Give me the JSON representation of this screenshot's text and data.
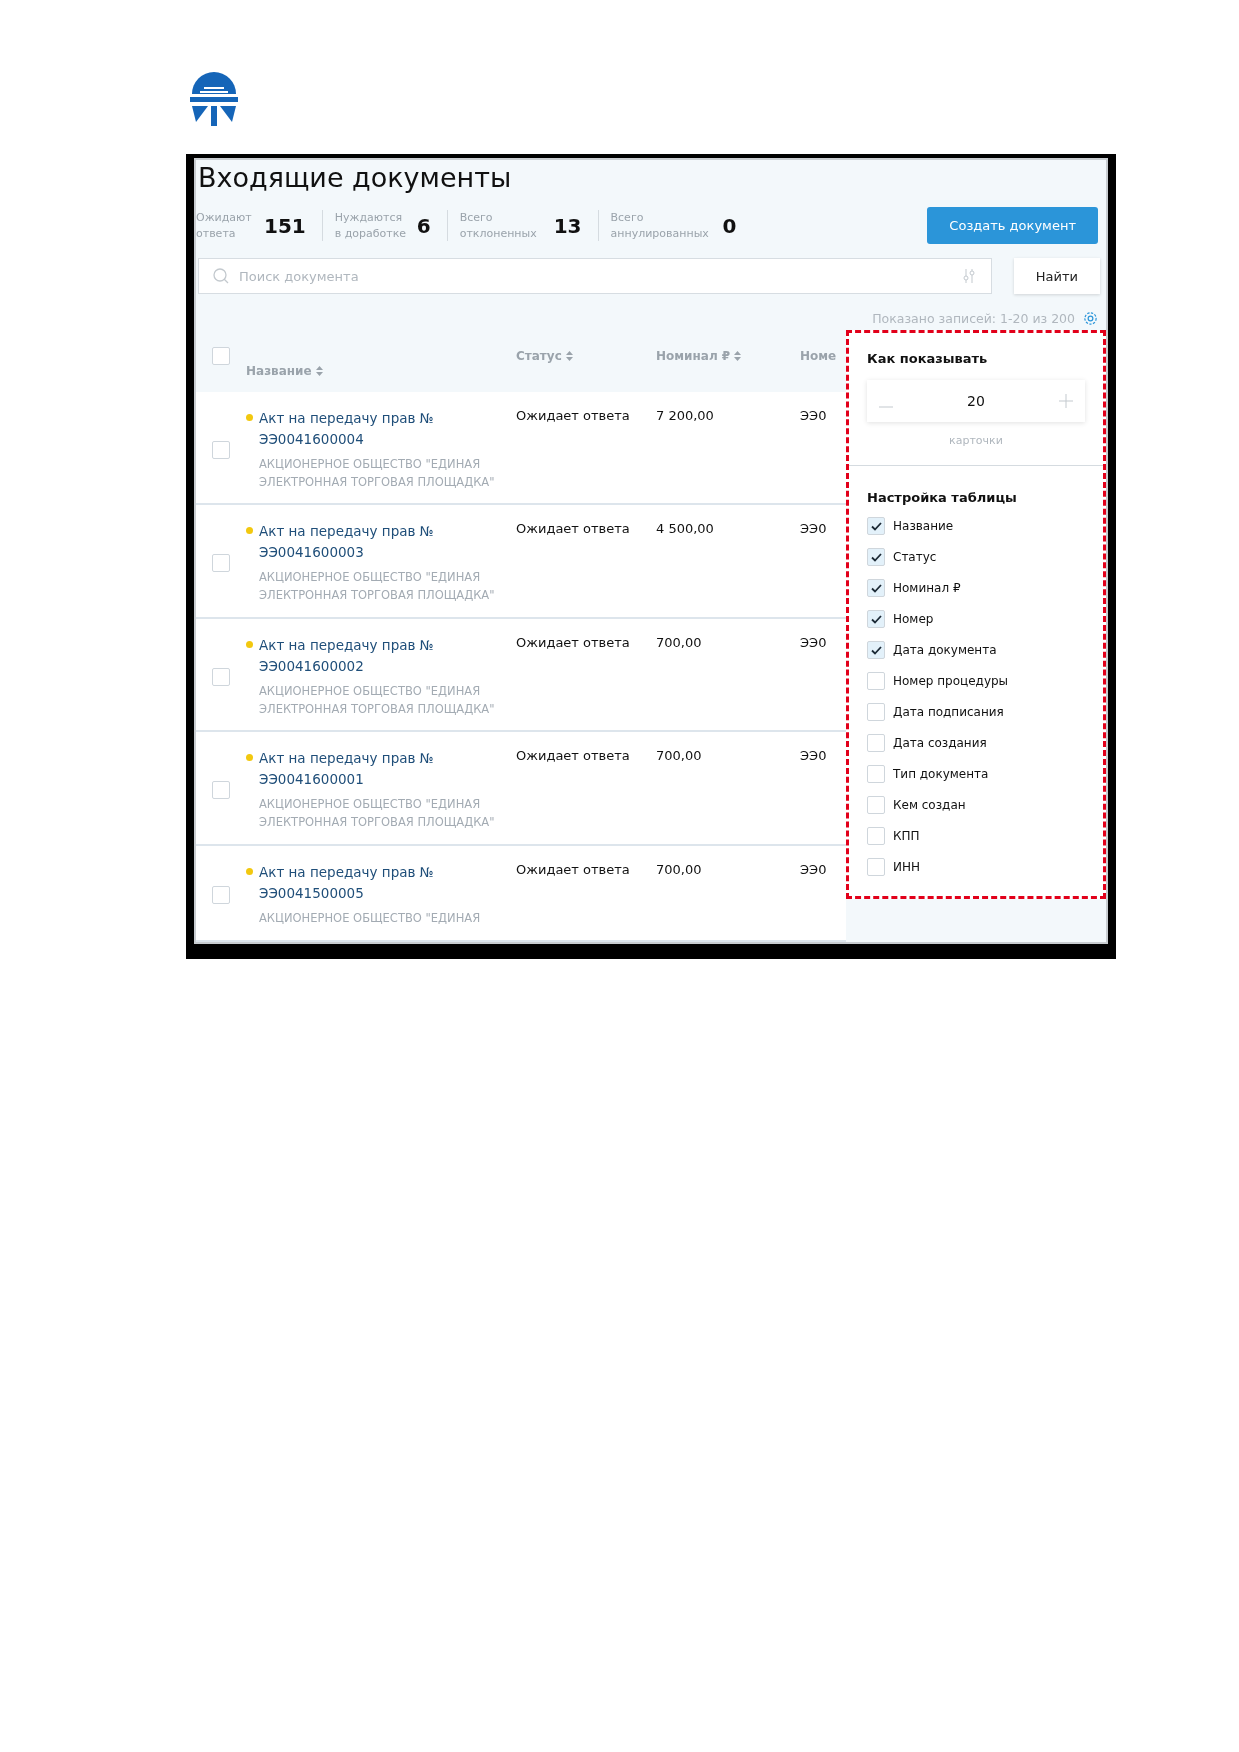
{
  "page": {
    "title": "Входящие документы"
  },
  "stats": [
    {
      "label": "Ожидают ответа",
      "value": "151"
    },
    {
      "label": "Нуждаются в доработке",
      "value": "6"
    },
    {
      "label": "Всего отклоненных",
      "value": "13"
    },
    {
      "label": "Всего аннулированных",
      "value": "0"
    }
  ],
  "create_button": "Создать документ",
  "search": {
    "placeholder": "Поиск документа",
    "button": "Найти"
  },
  "records_info": "Показано записей: 1-20 из 200",
  "table": {
    "select_all_checked": false,
    "columns": [
      "Название",
      "Статус",
      "Номинал ₽",
      "Номе"
    ],
    "rows": [
      {
        "checked": false,
        "title": "Акт на передачу прав № ЭЭ0041600004",
        "org": "АКЦИОНЕРНОЕ ОБЩЕСТВО \"ЕДИНАЯ ЭЛЕКТРОННАЯ ТОРГОВАЯ ПЛОЩАДКА\"",
        "status": "Ожидает ответа",
        "nominal": "7 200,00",
        "column_4": "ЭЭ0"
      },
      {
        "checked": false,
        "title": "Акт на передачу прав № ЭЭ0041600003",
        "org": "АКЦИОНЕРНОЕ ОБЩЕСТВО \"ЕДИНАЯ ЭЛЕКТРОННАЯ ТОРГОВАЯ ПЛОЩАДКА\"",
        "status": "Ожидает ответа",
        "nominal": "4 500,00",
        "column_4": "ЭЭ0"
      },
      {
        "checked": false,
        "title": "Акт на передачу прав № ЭЭ0041600002",
        "org": "АКЦИОНЕРНОЕ ОБЩЕСТВО \"ЕДИНАЯ ЭЛЕКТРОННАЯ ТОРГОВАЯ ПЛОЩАДКА\"",
        "status": "Ожидает ответа",
        "nominal": "700,00",
        "column_4": "ЭЭ0"
      },
      {
        "checked": false,
        "title": "Акт на передачу прав № ЭЭ0041600001",
        "org": "АКЦИОНЕРНОЕ ОБЩЕСТВО \"ЕДИНАЯ ЭЛЕКТРОННАЯ ТОРГОВАЯ ПЛОЩАДКА\"",
        "status": "Ожидает ответа",
        "nominal": "700,00",
        "column_4": "ЭЭ0"
      },
      {
        "checked": false,
        "title": "Акт на передачу прав № ЭЭ0041500005",
        "org": "АКЦИОНЕРНОЕ ОБЩЕСТВО \"ЕДИНАЯ",
        "status": "Ожидает ответа",
        "nominal": "700,00",
        "column_4": "ЭЭ0"
      }
    ]
  },
  "settings_panel": {
    "display_title": "Как показывать",
    "count": "20",
    "count_caption": "карточки",
    "table_title": "Настройка таблицы",
    "options": [
      {
        "label": "Название",
        "checked": true
      },
      {
        "label": "Статус",
        "checked": true
      },
      {
        "label": "Номинал ₽",
        "checked": true
      },
      {
        "label": "Номер",
        "checked": true
      },
      {
        "label": "Дата документа",
        "checked": true
      },
      {
        "label": "Номер процедуры",
        "checked": false
      },
      {
        "label": "Дата подписания",
        "checked": false
      },
      {
        "label": "Дата создания",
        "checked": false
      },
      {
        "label": "Тип документа",
        "checked": false
      },
      {
        "label": "Кем создан",
        "checked": false
      },
      {
        "label": "КПП",
        "checked": false
      },
      {
        "label": "ИНН",
        "checked": false
      }
    ]
  }
}
